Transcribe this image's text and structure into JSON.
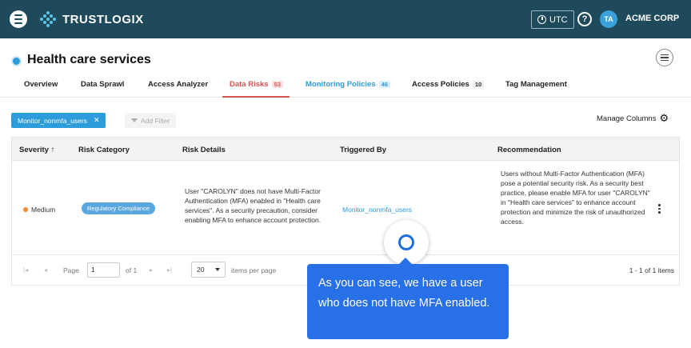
{
  "topbar": {
    "brand": "TRUSTLOGIX",
    "utc_label": "UTC",
    "help_glyph": "?",
    "avatar_initials": "TA",
    "org_name": "ACME CORP"
  },
  "page": {
    "title": "Health care services"
  },
  "tabs": [
    {
      "label": "Overview",
      "count": null
    },
    {
      "label": "Data Sprawl",
      "count": null
    },
    {
      "label": "Access Analyzer",
      "count": null
    },
    {
      "label": "Data Risks",
      "count": "53"
    },
    {
      "label": "Monitoring Policies",
      "count": "46"
    },
    {
      "label": "Access Policies",
      "count": "10"
    },
    {
      "label": "Tag Management",
      "count": null
    }
  ],
  "filters": {
    "active_chip": "Monitor_nonmfa_users",
    "chip_remove": "✕",
    "add_filter": "Add Filter",
    "manage_columns": "Manage Columns"
  },
  "table": {
    "columns": {
      "severity": "Severity",
      "severity_sort": "↑",
      "risk_category": "Risk Category",
      "risk_details": "Risk Details",
      "triggered_by": "Triggered By",
      "recommendation": "Recommendation"
    },
    "rows": [
      {
        "severity": "Medium",
        "risk_category": "Regulatory Compliance",
        "risk_details": "User \"CAROLYN\" does not have Multi-Factor Authentication (MFA) enabled in \"Health care services\". As a security precaution, consider enabling MFA to enhance account protection.",
        "triggered_by": "Monitor_nonmfa_users",
        "recommendation": "Users without Multi-Factor Authentication (MFA) pose a potential security risk. As a security best practice, please enable MFA for user \"CAROLYN\" in \"Health care services\" to enhance account protection and minimize the risk of unauthorized access."
      }
    ]
  },
  "pagination": {
    "page_label": "Page",
    "page_value": "1",
    "of_label": "of 1",
    "page_size": "20",
    "items_per_page": "items per page",
    "range": "1 - 1 of 1 items"
  },
  "tooltip": {
    "text": "As you can see, we have a user who does not have MFA enabled."
  },
  "colors": {
    "topbar": "#1e4a5c",
    "accent_blue": "#2d9cdb",
    "risk_red": "#d9534f",
    "medium_orange": "#f08a34",
    "tooltip_blue": "#2870e8"
  }
}
